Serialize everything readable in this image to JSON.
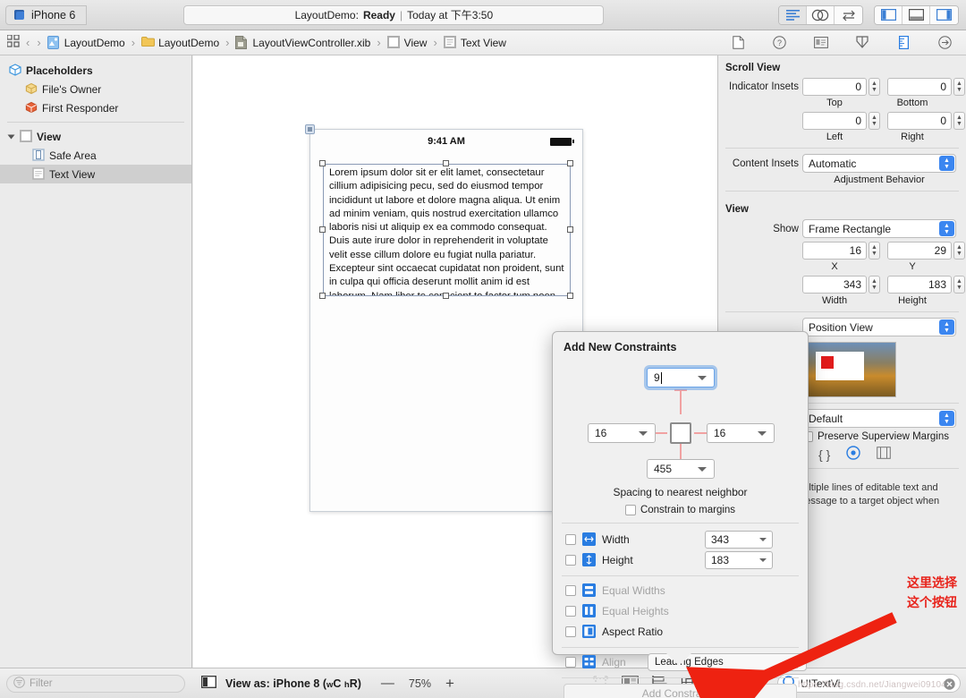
{
  "toolbar": {
    "scheme": "iPhone 6",
    "status_project": "LayoutDemo:",
    "status_state": "Ready",
    "status_sep": "|",
    "status_time": "Today at 下午3:50",
    "editor_icons": [
      "standard-editor-icon",
      "assistant-editor-icon",
      "version-editor-icon"
    ],
    "panel_icons": [
      "navigator-toggle-icon",
      "debug-toggle-icon",
      "utilities-toggle-icon"
    ]
  },
  "jumpbar": {
    "crumbs": [
      {
        "label": "LayoutDemo",
        "icon": "project-icon"
      },
      {
        "label": "LayoutDemo",
        "icon": "folder-icon"
      },
      {
        "label": "LayoutViewController.xib",
        "icon": "xib-file-icon"
      },
      {
        "label": "View",
        "icon": "view-icon"
      },
      {
        "label": "Text View",
        "icon": "textview-icon"
      }
    ],
    "separator": "›"
  },
  "inspector_tabs": [
    "file-inspector-icon",
    "quick-help-icon",
    "identity-inspector-icon",
    "attributes-inspector-icon",
    "size-inspector-icon",
    "connections-inspector-icon"
  ],
  "navigator": {
    "rows": [
      {
        "label": "Placeholders",
        "icon": "placeholder-cube-icon",
        "indent": 0,
        "bold": true,
        "selected": false
      },
      {
        "label": "File's Owner",
        "icon": "files-owner-icon",
        "indent": 1,
        "bold": false,
        "selected": false
      },
      {
        "label": "First Responder",
        "icon": "first-responder-icon",
        "indent": 1,
        "bold": false,
        "selected": false
      },
      {
        "label": "View",
        "icon": "view-icon",
        "indent": 0,
        "bold": true,
        "selected": false
      },
      {
        "label": "Safe Area",
        "icon": "safe-area-icon",
        "indent": 2,
        "bold": false,
        "selected": false
      },
      {
        "label": "Text View",
        "icon": "textview-icon",
        "indent": 2,
        "bold": false,
        "selected": true
      }
    ]
  },
  "canvas": {
    "status_time": "9:41 AM",
    "textview_body": "Lorem ipsum dolor sit er elit lamet, consectetaur cillium adipisicing pecu, sed do eiusmod tempor incididunt ut labore et dolore magna aliqua. Ut enim ad minim veniam, quis nostrud exercitation ullamco laboris nisi ut aliquip ex ea commodo consequat. Duis aute irure dolor in reprehenderit in voluptate velit esse cillum dolore eu fugiat nulla pariatur. Excepteur sint occaecat cupidatat non proident, sunt in culpa qui officia deserunt mollit anim id est laborum. Nam liber te conscient to factor tum poen legum odioque civiuda."
  },
  "inspector": {
    "scroll_view": {
      "title": "Scroll View",
      "indicator_insets_label": "Indicator Insets",
      "top": {
        "value": "0",
        "label": "Top"
      },
      "bottom": {
        "value": "0",
        "label": "Bottom"
      },
      "left": {
        "value": "0",
        "label": "Left"
      },
      "right": {
        "value": "0",
        "label": "Right"
      },
      "content_insets_label": "Content Insets",
      "content_insets_value": "Automatic",
      "adjustment_behavior_label": "Adjustment Behavior"
    },
    "view": {
      "title": "View",
      "show_label": "Show",
      "show_value": "Frame Rectangle",
      "x": {
        "value": "16",
        "label": "X"
      },
      "y": {
        "value": "29",
        "label": "Y"
      },
      "width": {
        "value": "343",
        "label": "Width"
      },
      "height": {
        "value": "183",
        "label": "Height"
      },
      "arrange_value": "Position View",
      "layout_value": "Default",
      "preserve_margins_label": "Preserve Superview Margins",
      "mini_icons": [
        "braces-icon",
        "target-icon",
        "layout-guides-icon"
      ],
      "description": "View - Displays multiple lines of editable text and sends an action message to a target object when Ret..."
    }
  },
  "popover": {
    "title": "Add New Constraints",
    "top_value": "9",
    "leading_value": "16",
    "trailing_value": "16",
    "bottom_value": "455",
    "spacing_label": "Spacing to nearest neighbor",
    "constrain_margins_label": "Constrain to margins",
    "rows": [
      {
        "label": "Width",
        "icon": "width-constraint-icon",
        "value": "343",
        "checked": false,
        "disabled": false
      },
      {
        "label": "Height",
        "icon": "height-constraint-icon",
        "value": "183",
        "checked": false,
        "disabled": false
      },
      {
        "label": "Equal Widths",
        "icon": "equal-widths-icon",
        "value": null,
        "checked": false,
        "disabled": true
      },
      {
        "label": "Equal Heights",
        "icon": "equal-heights-icon",
        "value": null,
        "checked": false,
        "disabled": true
      },
      {
        "label": "Aspect Ratio",
        "icon": "aspect-ratio-icon",
        "value": null,
        "checked": false,
        "disabled": false
      }
    ],
    "align_label": "Align",
    "align_value": "Leading Edges",
    "add_button": "Add Constraints"
  },
  "bottombar": {
    "filter_placeholder": "Filter",
    "view_as": "View as: iPhone 8 (",
    "view_as_wc": "w",
    "view_as_wc2": "C ",
    "view_as_hr": "h",
    "view_as_hr2": "R)",
    "zoom_out": "—",
    "zoom_value": "75%",
    "zoom_in": "+",
    "align_icons": [
      "update-frames-icon",
      "embed-in-icon",
      "align-icon",
      "pin-icon",
      "resolve-issues-icon",
      "stack-icon"
    ],
    "search_value": "UITextVi",
    "watermark": "https://blog.csdn.net/Jiangwei09104",
    "clear_icon": "clear-search-icon"
  },
  "annotation": {
    "line1": "这里选择",
    "line2": "这个按钮",
    "color": "#e8241c"
  }
}
